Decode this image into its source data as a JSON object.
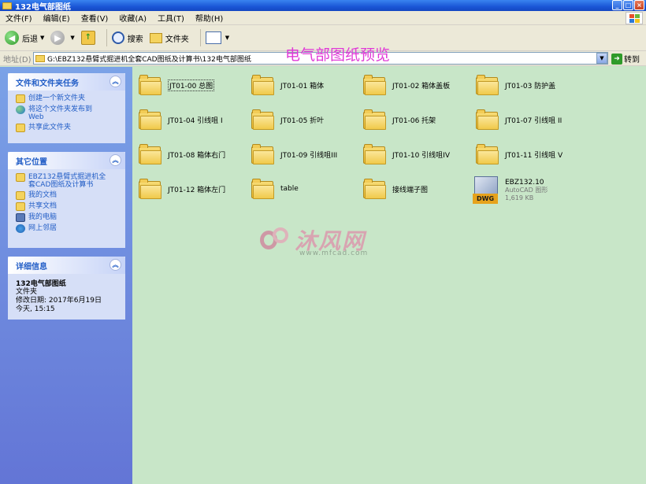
{
  "window": {
    "title": "132电气部图纸"
  },
  "menu": [
    "文件(F)",
    "编辑(E)",
    "查看(V)",
    "收藏(A)",
    "工具(T)",
    "帮助(H)"
  ],
  "toolbar": {
    "back_label": "后退",
    "search_label": "搜索",
    "folders_label": "文件夹"
  },
  "address": {
    "label": "地址(D)",
    "path": "G:\\EBZ132悬臂式掘进机全套CAD图纸及计算书\\132电气部图纸",
    "go_label": "转到"
  },
  "overlay_title": "电气部图纸预览",
  "sidebar": {
    "tasks": {
      "title": "文件和文件夹任务",
      "items": [
        "创建一个新文件夹",
        "将这个文件夹发布到",
        "Web",
        "共享此文件夹"
      ]
    },
    "places": {
      "title": "其它位置",
      "items": [
        "EBZ132悬臂式掘进机全",
        "套CAD图纸及计算书",
        "我的文档",
        "共享文档",
        "我的电脑",
        "网上邻居"
      ]
    },
    "details": {
      "title": "详细信息",
      "name": "132电气部图纸",
      "type": "文件夹",
      "modified": "修改日期: 2017年6月19日",
      "time": "今天, 15:15"
    }
  },
  "files": [
    "JT01-00 总图",
    "JT01-01 箱体",
    "JT01-02 箱体盖板",
    "JT01-03 防护盖",
    "JT01-04 引线咀 I",
    "JT01-05 折叶",
    "JT01-06 托架",
    "JT01-07 引线咀 II",
    "JT01-08 箱体右门",
    "JT01-09 引线咀III",
    "JT01-10 引线咀IV",
    "JT01-11 引线咀 V",
    "JT01-12 箱体左门",
    "table",
    "接线端子图"
  ],
  "dwg_file": {
    "name": "EBZ132.10",
    "type": "AutoCAD 图形",
    "size": "1,619 KB",
    "badge": "DWG"
  },
  "watermark": {
    "text": "沐风网",
    "url": "www.mfcad.com"
  }
}
